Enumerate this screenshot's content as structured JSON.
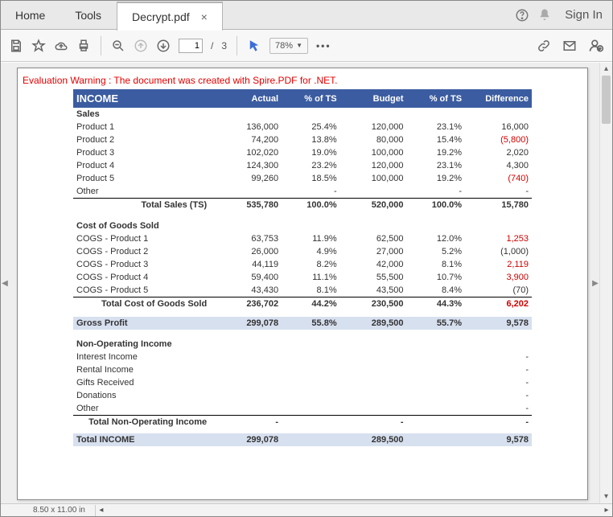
{
  "tabs": {
    "home": "Home",
    "tools": "Tools",
    "file": "Decrypt.pdf"
  },
  "top": {
    "signin": "Sign In"
  },
  "toolbar": {
    "page_current": "1",
    "page_sep": "/",
    "page_total": "3",
    "zoom": "78%"
  },
  "warning": "Evaluation Warning : The document was created with Spire.PDF for .NET.",
  "headers": {
    "c0": "INCOME",
    "c1": "Actual",
    "c2": "% of TS",
    "c3": "Budget",
    "c4": "% of TS",
    "c5": "Difference"
  },
  "sales": {
    "title": "Sales",
    "rows": [
      {
        "n": "Product 1",
        "a": "136,000",
        "p": "25.4%",
        "b": "120,000",
        "bp": "23.1%",
        "d": "16,000",
        "neg": false
      },
      {
        "n": "Product 2",
        "a": "74,200",
        "p": "13.8%",
        "b": "80,000",
        "bp": "15.4%",
        "d": "(5,800)",
        "neg": true
      },
      {
        "n": "Product 3",
        "a": "102,020",
        "p": "19.0%",
        "b": "100,000",
        "bp": "19.2%",
        "d": "2,020",
        "neg": false
      },
      {
        "n": "Product 4",
        "a": "124,300",
        "p": "23.2%",
        "b": "120,000",
        "bp": "23.1%",
        "d": "4,300",
        "neg": false
      },
      {
        "n": "Product 5",
        "a": "99,260",
        "p": "18.5%",
        "b": "100,000",
        "bp": "19.2%",
        "d": "(740)",
        "neg": true
      },
      {
        "n": "Other",
        "a": "",
        "p": "-",
        "b": "",
        "bp": "-",
        "d": "-",
        "neg": false
      }
    ],
    "total": {
      "label": "Total Sales (TS)",
      "a": "535,780",
      "p": "100.0%",
      "b": "520,000",
      "bp": "100.0%",
      "d": "15,780",
      "neg": false
    }
  },
  "cogs": {
    "title": "Cost of Goods Sold",
    "rows": [
      {
        "n": "COGS - Product 1",
        "a": "63,753",
        "p": "11.9%",
        "b": "62,500",
        "bp": "12.0%",
        "d": "1,253",
        "neg": true
      },
      {
        "n": "COGS - Product 2",
        "a": "26,000",
        "p": "4.9%",
        "b": "27,000",
        "bp": "5.2%",
        "d": "(1,000)",
        "neg": false
      },
      {
        "n": "COGS - Product 3",
        "a": "44,119",
        "p": "8.2%",
        "b": "42,000",
        "bp": "8.1%",
        "d": "2,119",
        "neg": true
      },
      {
        "n": "COGS - Product 4",
        "a": "59,400",
        "p": "11.1%",
        "b": "55,500",
        "bp": "10.7%",
        "d": "3,900",
        "neg": true
      },
      {
        "n": "COGS - Product 5",
        "a": "43,430",
        "p": "8.1%",
        "b": "43,500",
        "bp": "8.4%",
        "d": "(70)",
        "neg": false
      }
    ],
    "total": {
      "label": "Total Cost of Goods Sold",
      "a": "236,702",
      "p": "44.2%",
      "b": "230,500",
      "bp": "44.3%",
      "d": "6,202",
      "neg": true
    }
  },
  "gross": {
    "label": "Gross Profit",
    "a": "299,078",
    "p": "55.8%",
    "b": "289,500",
    "bp": "55.7%",
    "d": "9,578"
  },
  "nonop": {
    "title": "Non-Operating Income",
    "rows": [
      {
        "n": "Interest Income",
        "d": "-"
      },
      {
        "n": "Rental Income",
        "d": "-"
      },
      {
        "n": "Gifts Received",
        "d": "-"
      },
      {
        "n": "Donations",
        "d": "-"
      },
      {
        "n": "Other",
        "d": "-"
      }
    ],
    "total": {
      "label": "Total Non-Operating Income",
      "a": "-",
      "b": "-",
      "d": "-"
    }
  },
  "totalincome": {
    "label": "Total INCOME",
    "a": "299,078",
    "b": "289,500",
    "d": "9,578"
  },
  "status": {
    "dim": "8.50 x 11.00 in"
  }
}
